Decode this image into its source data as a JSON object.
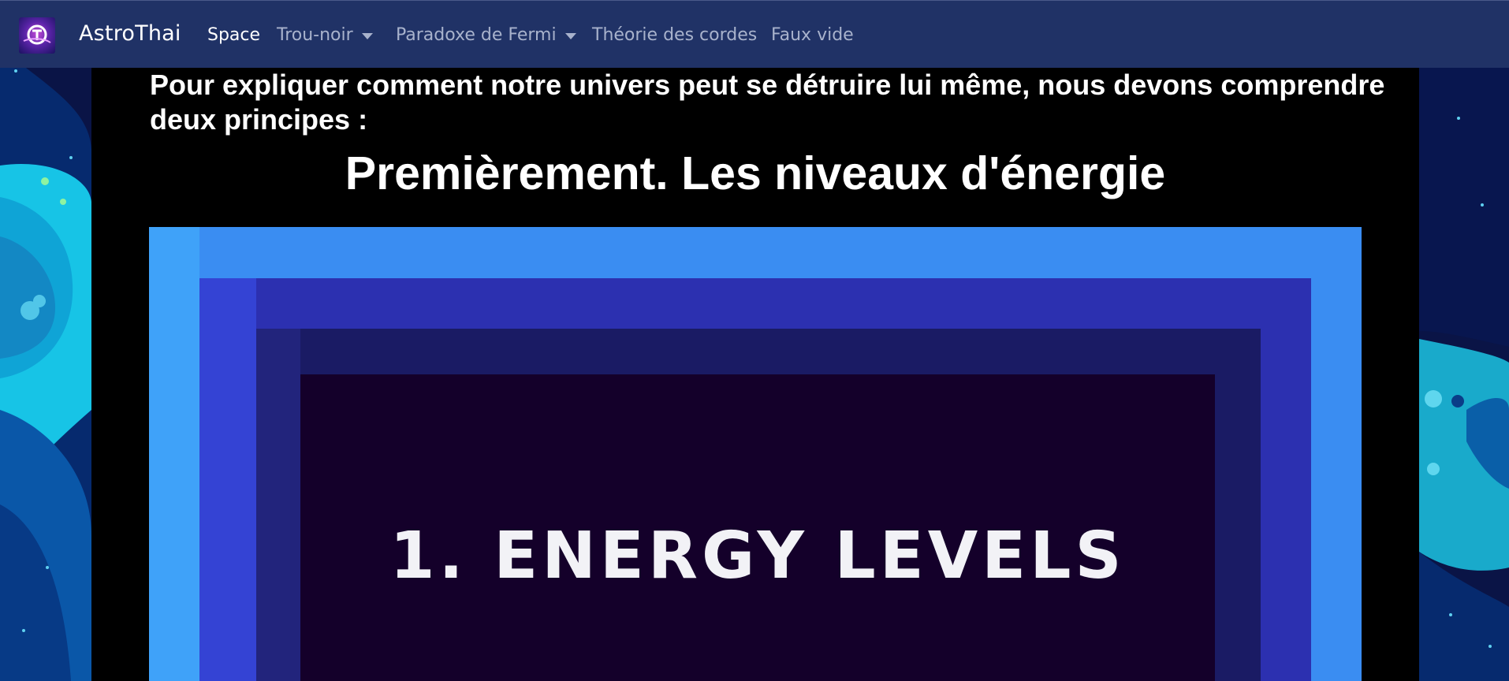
{
  "navbar": {
    "brand": "AstroThai",
    "items": [
      {
        "label": "Space",
        "active": true,
        "dropdown": false
      },
      {
        "label": "Trou-noir",
        "active": false,
        "dropdown": true
      },
      {
        "label": "Paradoxe de Fermi",
        "active": false,
        "dropdown": true
      },
      {
        "label": "Théorie des cordes",
        "active": false,
        "dropdown": false
      },
      {
        "label": "Faux vide",
        "active": false,
        "dropdown": false
      }
    ]
  },
  "main": {
    "intro": "Pour expliquer comment notre univers peut se détruire lui même, nous devons comprendre deux principes :",
    "heading": "Premièrement. Les niveaux d'énergie",
    "figure_text": "1. ENERGY LEVELS"
  },
  "colors": {
    "navbar_bg": "#203266",
    "content_bg": "#000000",
    "figure_outer": "#3a8df2",
    "figure_inner": "#14002a"
  }
}
